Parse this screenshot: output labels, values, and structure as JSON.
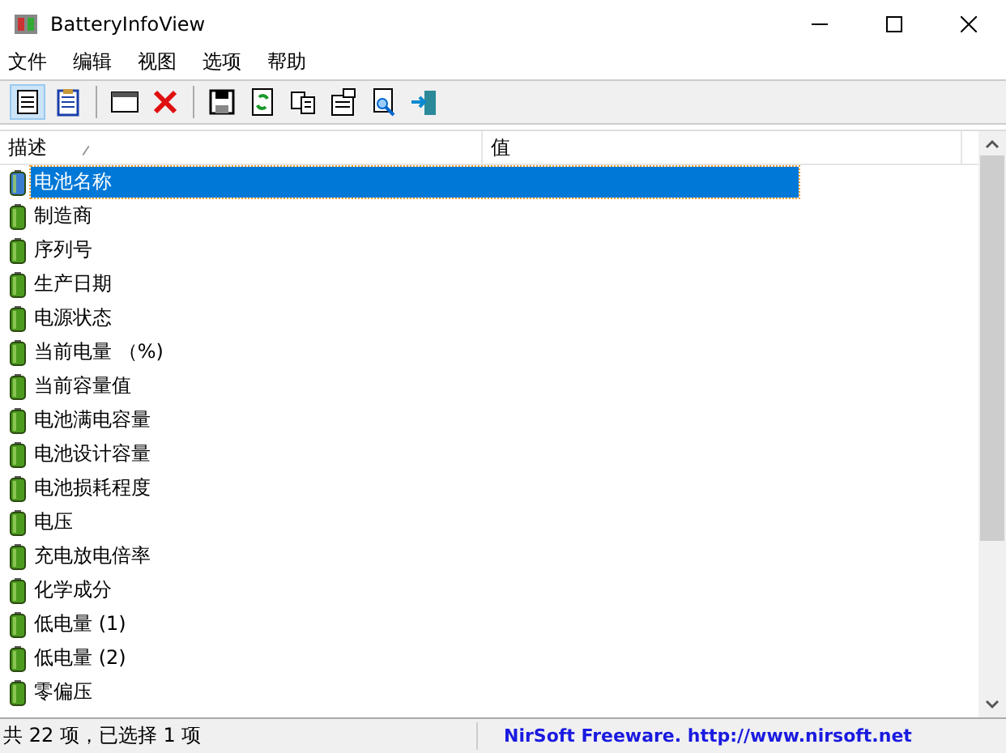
{
  "window": {
    "title": "BatteryInfoView"
  },
  "menu": [
    "文件",
    "编辑",
    "视图",
    "选项",
    "帮助"
  ],
  "toolbar": [
    {
      "kind": "details",
      "selected": true
    },
    {
      "kind": "clipboard",
      "selected": false
    },
    {
      "kind": "window",
      "selected": false
    },
    {
      "kind": "delete",
      "selected": false
    },
    {
      "kind": "save",
      "selected": false
    },
    {
      "kind": "refresh",
      "selected": false
    },
    {
      "kind": "copy",
      "selected": false
    },
    {
      "kind": "properties",
      "selected": false
    },
    {
      "kind": "search",
      "selected": false
    },
    {
      "kind": "exit",
      "selected": false
    }
  ],
  "table": {
    "columns": [
      "描述",
      "值"
    ],
    "rows": [
      {
        "name": "电池名称",
        "selected": true
      },
      {
        "name": "制造商",
        "selected": false
      },
      {
        "name": "序列号",
        "selected": false
      },
      {
        "name": "生产日期",
        "selected": false
      },
      {
        "name": "电源状态",
        "selected": false
      },
      {
        "name": "当前电量 （%)",
        "selected": false
      },
      {
        "name": "当前容量值",
        "selected": false
      },
      {
        "name": "电池满电容量",
        "selected": false
      },
      {
        "name": "电池设计容量",
        "selected": false
      },
      {
        "name": "电池损耗程度",
        "selected": false
      },
      {
        "name": "电压",
        "selected": false
      },
      {
        "name": "充电放电倍率",
        "selected": false
      },
      {
        "name": "化学成分",
        "selected": false
      },
      {
        "name": "低电量 (1)",
        "selected": false
      },
      {
        "name": "低电量 (2)",
        "selected": false
      },
      {
        "name": "零偏压",
        "selected": false
      }
    ]
  },
  "status_bar": {
    "count": "共 22 项，已选择 1 项",
    "credit": "NirSoft Freeware.  http://www.nirsoft.net"
  }
}
